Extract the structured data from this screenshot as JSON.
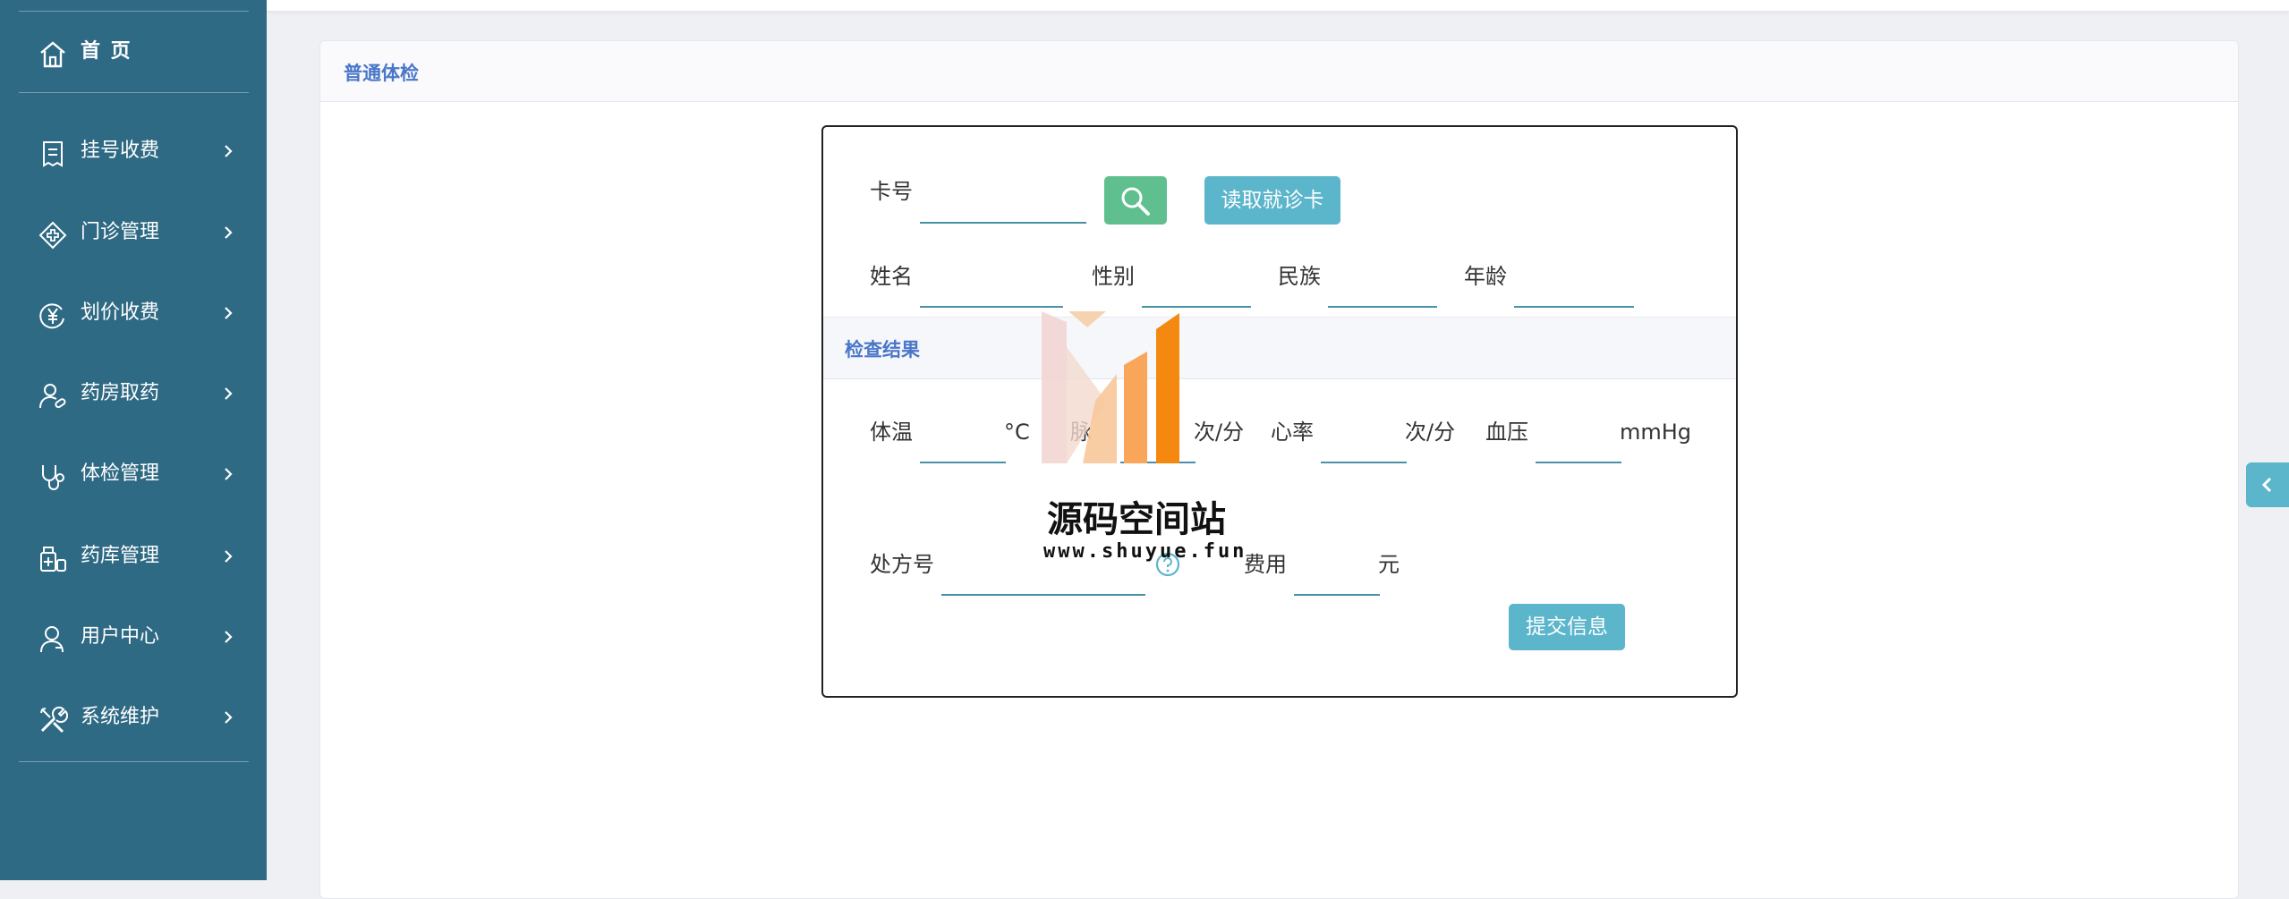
{
  "sidebar": {
    "home": "首 页",
    "items": [
      {
        "label": "挂号收费",
        "icon": "register-fee-icon"
      },
      {
        "label": "门诊管理",
        "icon": "clinic-icon"
      },
      {
        "label": "划价收费",
        "icon": "yuan-coin-icon"
      },
      {
        "label": "药房取药",
        "icon": "pharmacy-user-icon"
      },
      {
        "label": "体检管理",
        "icon": "stethoscope-icon"
      },
      {
        "label": "药库管理",
        "icon": "medicine-store-icon"
      },
      {
        "label": "用户中心",
        "icon": "user-icon"
      },
      {
        "label": "系统维护",
        "icon": "tools-icon"
      }
    ]
  },
  "panel": {
    "title": "普通体检"
  },
  "form": {
    "card_no_label": "卡号",
    "card_no_value": "",
    "read_card_button": "读取就诊卡",
    "name_label": "姓名",
    "gender_label": "性别",
    "ethnicity_label": "民族",
    "age_label": "年龄",
    "section_title": "检查结果",
    "temp_label": "体温",
    "temp_unit": "°C",
    "pulse_label": "脉",
    "pulse_unit": "次/分",
    "heart_rate_label": "心率",
    "heart_rate_unit": "次/分",
    "blood_pressure_label": "血压",
    "blood_pressure_unit": "mmHg",
    "prescription_label": "处方号",
    "fee_label": "费用",
    "fee_unit": "元",
    "submit_button": "提交信息"
  },
  "watermark": {
    "title": "源码空间站",
    "url": "www.shuyue.fun"
  },
  "colors": {
    "sidebar_bg": "#2f6a84",
    "accent": "#5bb5cb",
    "search_green": "#5fbf8e",
    "title_blue": "#4a76c9"
  }
}
